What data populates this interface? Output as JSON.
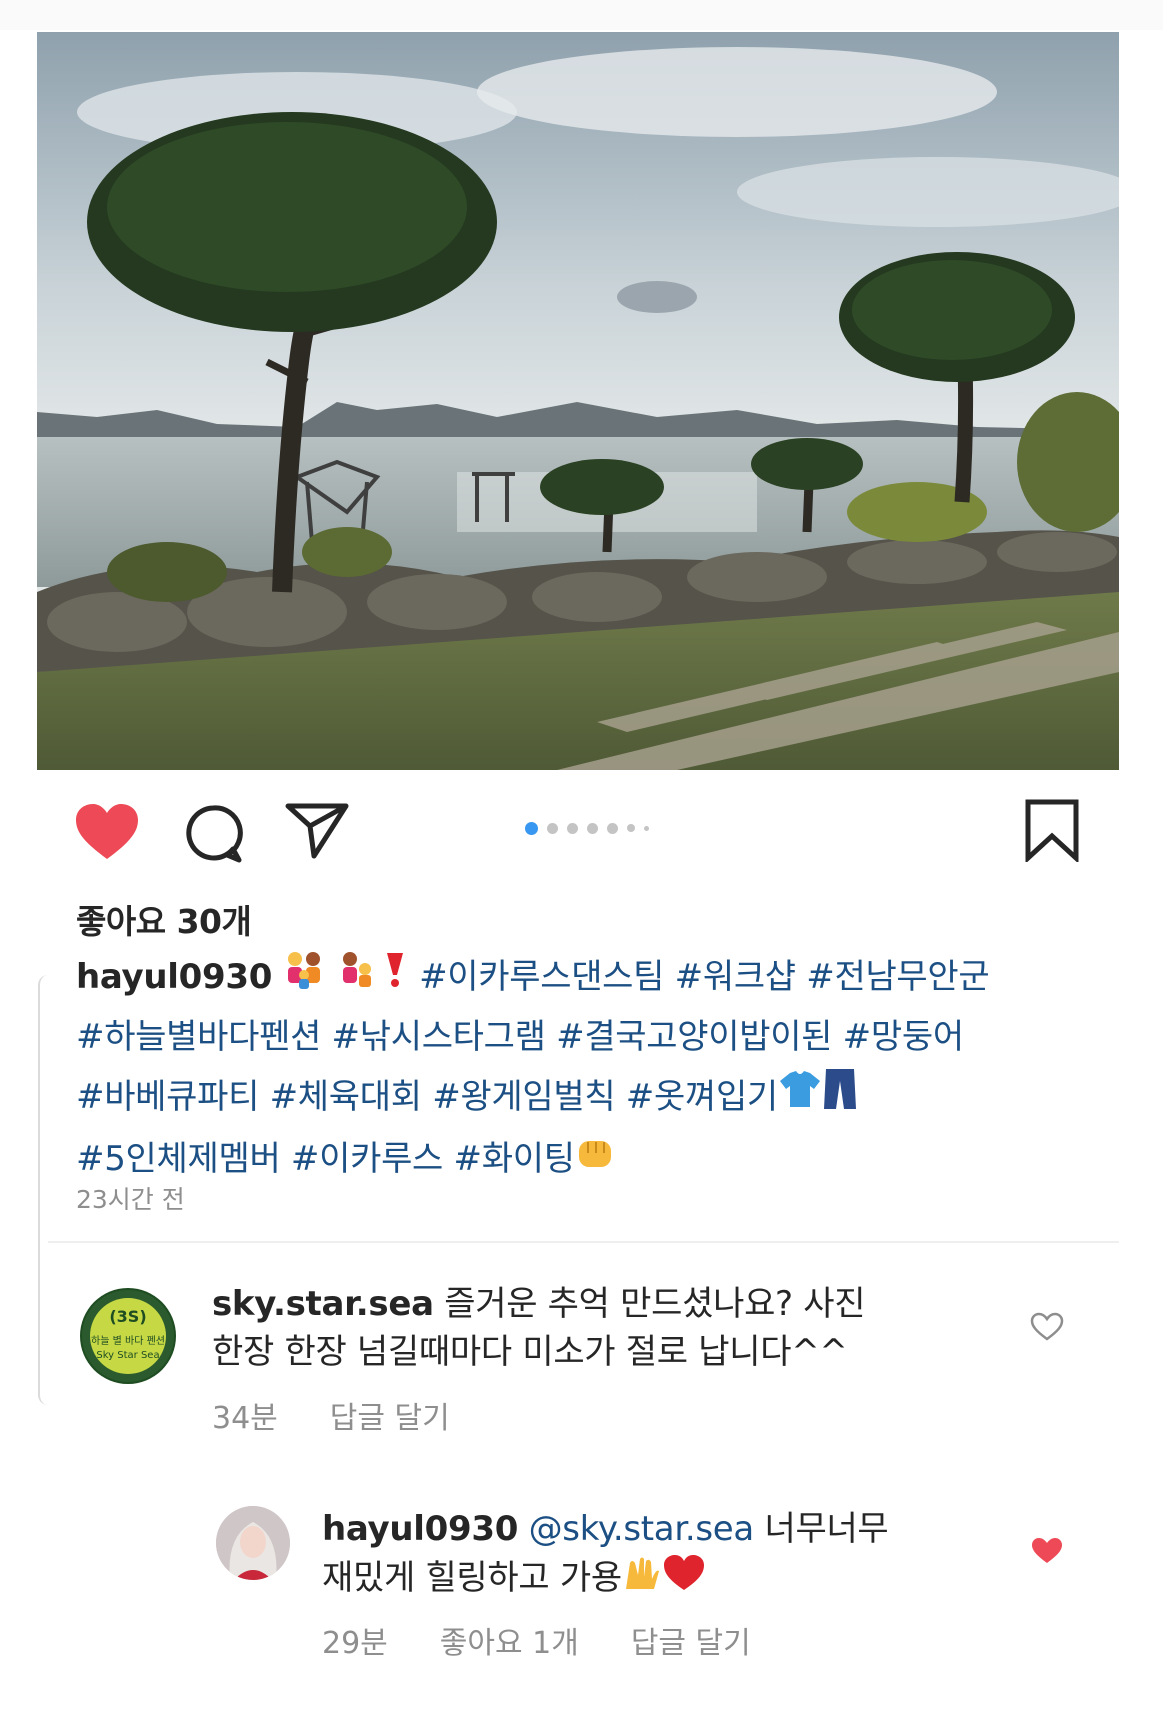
{
  "post": {
    "photo_description_icon": "landscape-photo",
    "likes_text": "좋아요 30개",
    "caption": {
      "username": "hayul0930",
      "line1_tags": "#이카루스댄스팀 #워크샵 #전남무안군",
      "line2_tags": "#하늘별바다펜션 #낚시스타그램 #결국고양이밥이된 #망둥어",
      "line3_tags": "#바베큐파티 #체육대회 #왕게임벌칙 #옷껴입기",
      "line4_tags": "#5인체제멤버 #이카루스 #화이팅"
    },
    "timestamp": "23시간 전",
    "carousel_dots": 7
  },
  "comments": [
    {
      "username": "sky.star.sea",
      "text_line1": "즐거운 추억 만드셨나요? 사진",
      "text_line2": "한장 한장 넘길때마다 미소가 절로 납니다^^",
      "time": "34분",
      "reply_label": "답글 달기",
      "avatar_text_1": "하늘 별 바다 펜션",
      "avatar_text_2": "Sky Star Sea"
    }
  ],
  "reply": {
    "username": "hayul0930",
    "mention": "@sky.star.sea",
    "text_line1_rest": "너무너무",
    "text_line2": "재밌게 힐링하고 가용",
    "time": "29분",
    "likes_label": "좋아요 1개",
    "reply_label": "답글 달기"
  },
  "colors": {
    "like_red": "#ed4956",
    "hashtag_blue": "#1c4f83",
    "dot_active": "#3897f0",
    "muted": "#8e8e8e"
  }
}
